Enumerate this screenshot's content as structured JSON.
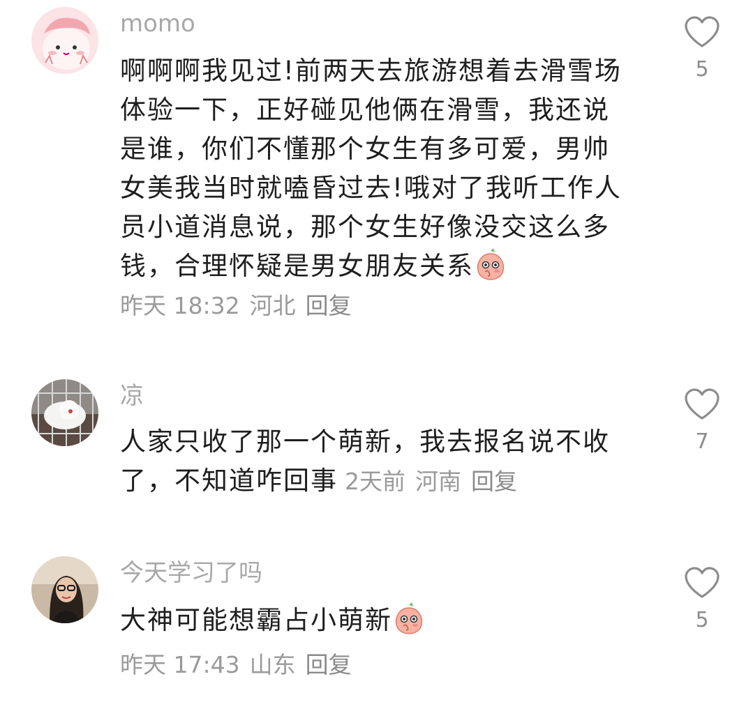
{
  "comments": [
    {
      "username": "momo",
      "text": "啊啊啊我见过!前两天去旅游想着去滑雪场体验一下，正好碰见他俩在滑雪，我还说是谁，你们不懂那个女生有多可爱，男帅女美我当时就嗑昏过去!哦对了我听工作人员小道消息说，那个女生好像没交这么多钱，合理怀疑是男女朋友关系",
      "emoji": "peach-blush-emoji",
      "time": "昨天 18:32",
      "location": "河北",
      "reply": "回复",
      "likes": "5",
      "avatar": "pink-cartoon-avatar"
    },
    {
      "username": "凉",
      "text": "人家只收了那一个萌新，我去报名说不收了，不知道咋回事",
      "time": "2天前",
      "location": "河南",
      "reply": "回复",
      "likes": "7",
      "avatar": "white-dog-avatar"
    },
    {
      "username": "今天学习了吗",
      "text": "大神可能想霸占小萌新",
      "emoji": "peach-blush-emoji",
      "time": "昨天 17:43",
      "location": "山东",
      "reply": "回复",
      "likes": "5",
      "avatar": "woman-glasses-avatar"
    }
  ],
  "colors": {
    "username": "#a8a8a8",
    "text": "#1e1e1e",
    "meta": "#9a9a9a",
    "like_icon": "#8c8c8c"
  },
  "icons": [
    "heart-outline-icon"
  ]
}
